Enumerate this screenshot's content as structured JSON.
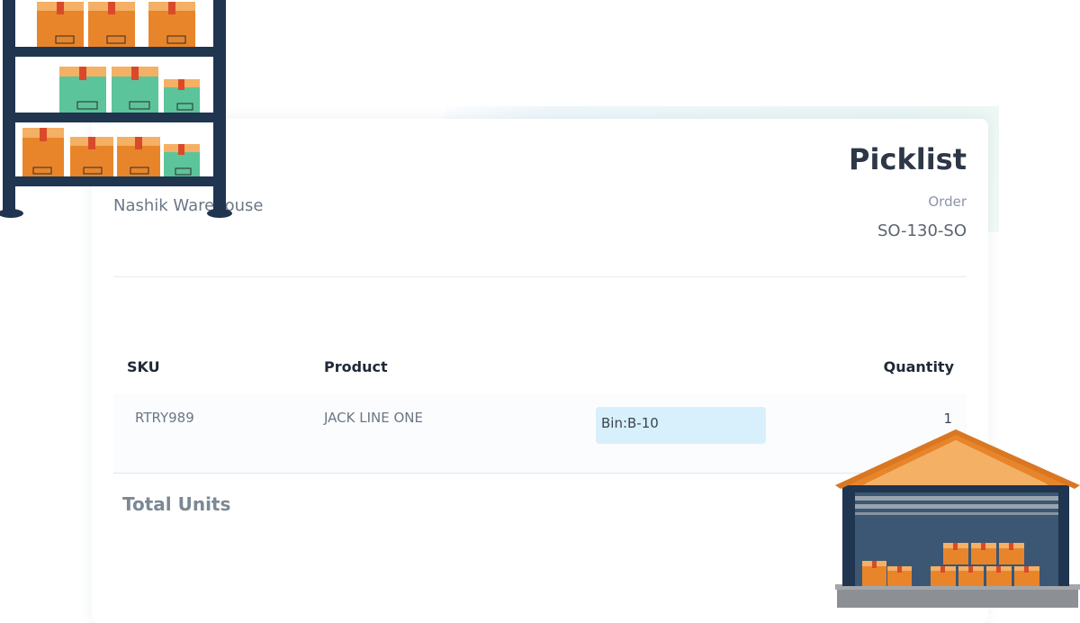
{
  "picklist": {
    "title": "Picklist",
    "order_label": "Order",
    "order_number": "SO-130-SO",
    "warehouse": "Nashik Warehouse"
  },
  "table": {
    "headers": {
      "sku": "SKU",
      "product": "Product",
      "quantity": "Quantity"
    },
    "rows": [
      {
        "sku": "RTRY989",
        "product": "JACK LINE ONE",
        "bin": "Bin:B-10",
        "quantity": "1"
      }
    ]
  },
  "summary": {
    "total_label": "Total Units"
  },
  "illustrations": {
    "left": "warehouse-shelf-icon",
    "right": "warehouse-building-icon"
  },
  "colors": {
    "title": "#2d3748",
    "bin_badge": "#d8f0fb",
    "box_orange": "#e8852a",
    "box_green": "#5cc49a",
    "shelf_frame": "#1f3550",
    "roof_orange": "#e8852a"
  }
}
